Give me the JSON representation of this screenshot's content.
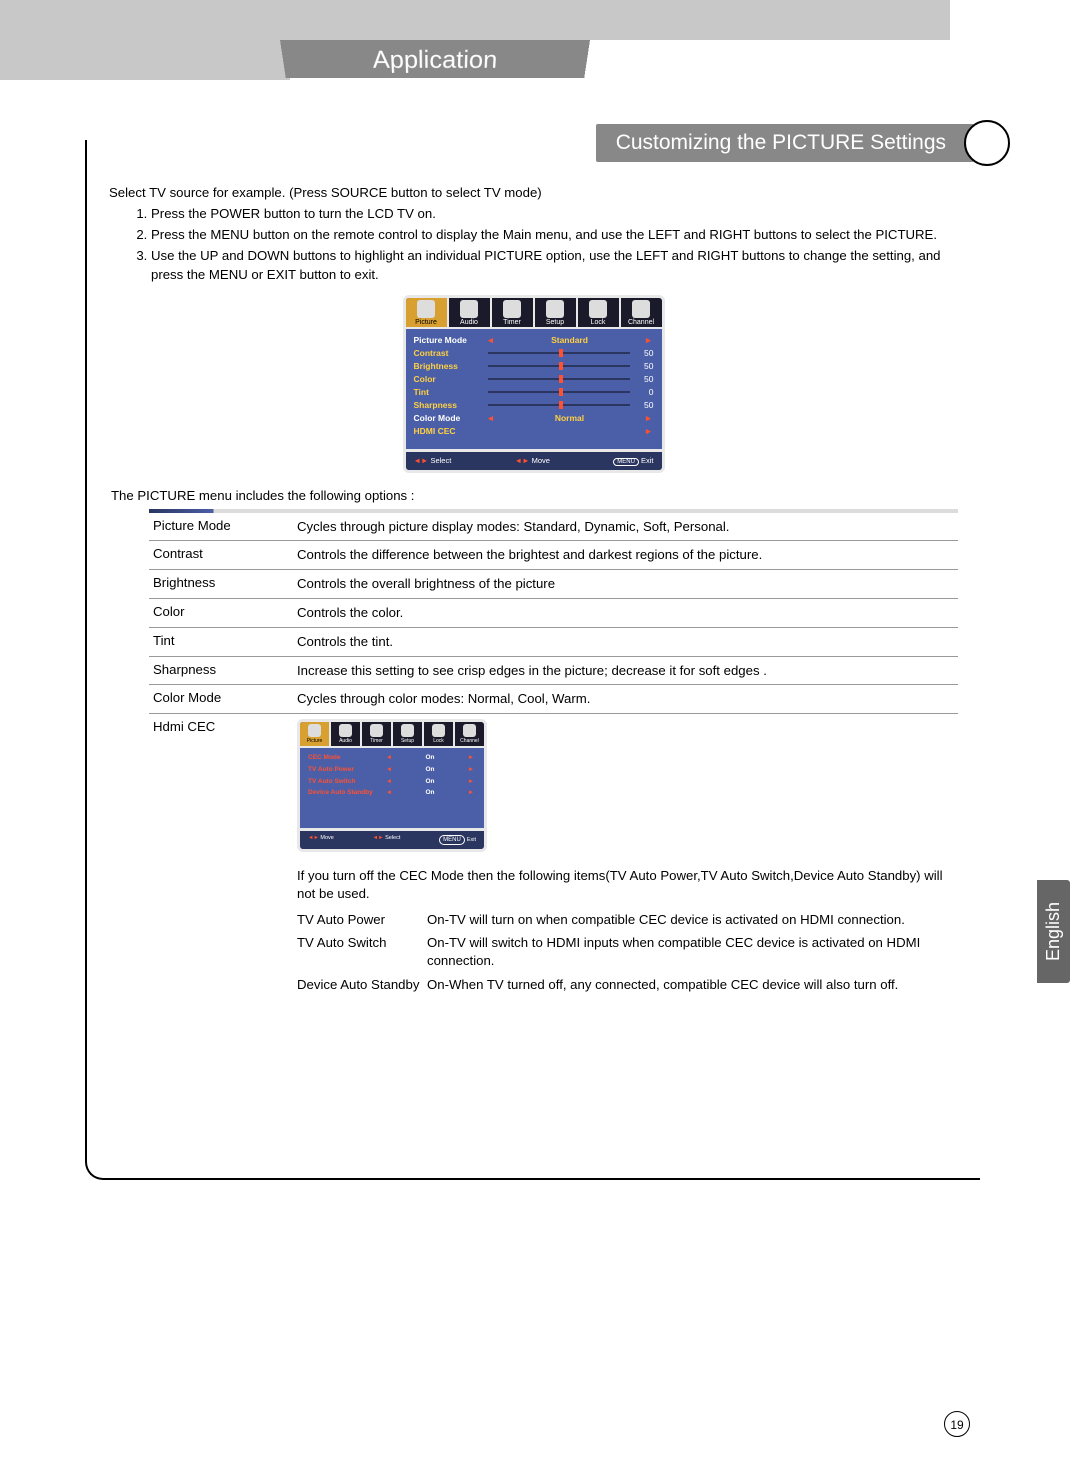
{
  "header": {
    "app_title": "Application",
    "section_title": "Customizing the PICTURE Settings"
  },
  "intro": "Select TV source for example. (Press SOURCE button to select TV mode)",
  "steps": [
    "Press the POWER button to turn the LCD TV on.",
    "Press the MENU button on the remote control to display the Main menu, and use the LEFT and RIGHT buttons to select the PICTURE.",
    "Use the UP and DOWN buttons to highlight an individual PICTURE option, use the LEFT and RIGHT buttons to change the setting, and press the MENU or EXIT button to exit."
  ],
  "osd_main": {
    "tabs": [
      "Picture",
      "Audio",
      "Timer",
      "Setup",
      "Lock",
      "Channel"
    ],
    "rows": [
      {
        "label": "Picture Mode",
        "type": "select",
        "value": "Standard"
      },
      {
        "label": "Contrast",
        "type": "slider",
        "value": "50"
      },
      {
        "label": "Brightness",
        "type": "slider",
        "value": "50"
      },
      {
        "label": "Color",
        "type": "slider",
        "value": "50"
      },
      {
        "label": "Tint",
        "type": "slider",
        "value": "0"
      },
      {
        "label": "Sharpness",
        "type": "slider",
        "value": "50"
      },
      {
        "label": "Color Mode",
        "type": "select",
        "value": "Normal"
      },
      {
        "label": "HDMI CEC",
        "type": "nav",
        "value": ""
      }
    ],
    "foot": {
      "a": "Select",
      "b": "Move",
      "c": "Exit",
      "c_btn": "MENU"
    }
  },
  "post_osd": "The PICTURE menu includes the following options :",
  "options": [
    {
      "name": "Picture Mode",
      "desc": "Cycles through picture display modes: Standard, Dynamic, Soft, Personal."
    },
    {
      "name": "Contrast",
      "desc": "Controls the difference between the brightest and darkest regions of the picture."
    },
    {
      "name": "Brightness",
      "desc": "Controls the overall brightness of the picture"
    },
    {
      "name": "Color",
      "desc": "Controls the color."
    },
    {
      "name": "Tint",
      "desc": "Controls the tint."
    },
    {
      "name": "Sharpness",
      "desc": "Increase this setting to see crisp edges in the picture; decrease it for soft edges ."
    },
    {
      "name": "Color Mode",
      "desc": "Cycles through color modes: Normal, Cool, Warm."
    },
    {
      "name": "Hdmi CEC",
      "desc": ""
    }
  ],
  "osd_cec": {
    "tabs": [
      "Picture",
      "Audio",
      "Timer",
      "Setup",
      "Lock",
      "Channel"
    ],
    "rows": [
      {
        "label": "CEC Mode",
        "value": "On"
      },
      {
        "label": "TV Auto Power",
        "value": "On"
      },
      {
        "label": "TV Auto Switch",
        "value": "On"
      },
      {
        "label": "Device Auto Standby",
        "value": "On"
      }
    ],
    "foot": {
      "a": "Move",
      "b": "Select",
      "c": "Exit",
      "c_btn": "MENU"
    }
  },
  "cec_note": "If you turn off the CEC Mode then the following items(TV Auto Power,TV Auto Switch,Device Auto Standby) will not be used.",
  "cec_sub": [
    {
      "name": "TV Auto Power",
      "desc": "On-TV will turn on when compatible CEC device is activated on HDMI connection."
    },
    {
      "name": "TV Auto Switch",
      "desc": "On-TV will switch to HDMI inputs when compatible CEC device is activated on HDMI connection."
    },
    {
      "name": "Device Auto Standby",
      "desc": "On-When TV turned off, any connected, compatible CEC device will also turn off."
    }
  ],
  "language_tab": "English",
  "page_number": "19"
}
